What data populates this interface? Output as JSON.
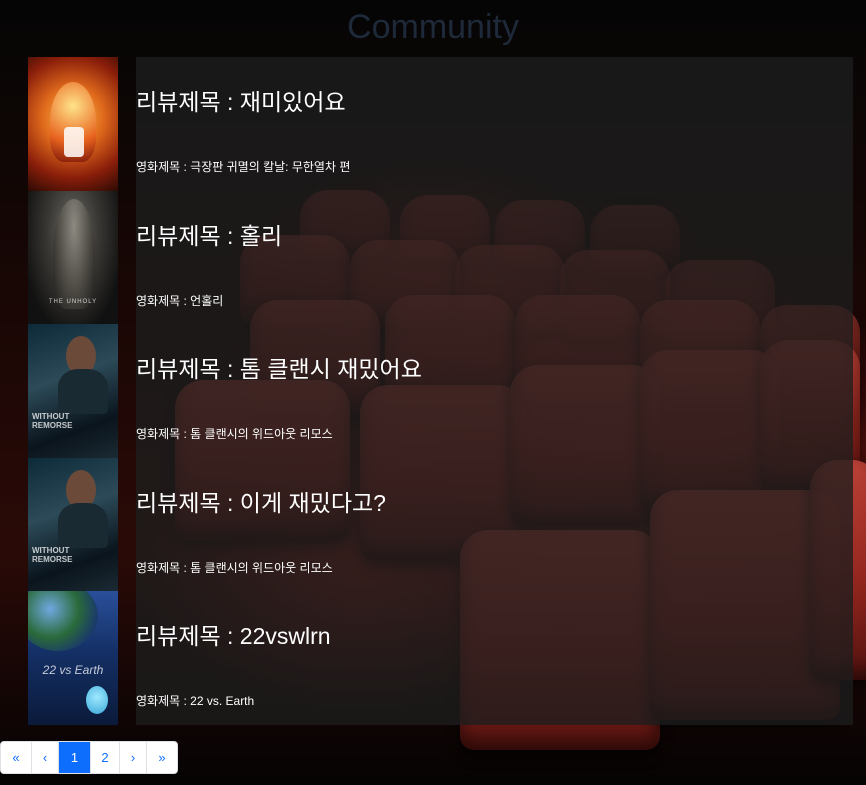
{
  "header": {
    "title": "Community"
  },
  "reviews": [
    {
      "review_title": "리뷰제목 : 재미있어요",
      "movie_title": "영화제목 : 극장판 귀멸의 칼날: 무한열차 편"
    },
    {
      "review_title": "리뷰제목 : 홀리",
      "movie_title": "영화제목 : 언홀리"
    },
    {
      "review_title": "리뷰제목 : 톰 클랜시 재밌어요",
      "movie_title": "영화제목 : 톰 클랜시의 위드아웃 리모스"
    },
    {
      "review_title": "리뷰제목 : 이게 재밌다고?",
      "movie_title": "영화제목 : 톰 클랜시의 위드아웃 리모스"
    },
    {
      "review_title": "리뷰제목 : 22vswlrn",
      "movie_title": "영화제목 : 22 vs. Earth"
    }
  ],
  "posters": {
    "p2_caption": "THE UNHOLY",
    "p3_caption": "WITHOUT REMORSE",
    "p4_caption": "WITHOUT REMORSE",
    "p5_caption": "22 vs Earth"
  },
  "pagination": {
    "first": "«",
    "prev": "‹",
    "page1": "1",
    "page2": "2",
    "next": "›",
    "last": "»",
    "active_page": 1
  },
  "colors": {
    "accent": "#0d6efd",
    "title": "#1e2a3a",
    "card_bg": "#1e1e1e"
  }
}
